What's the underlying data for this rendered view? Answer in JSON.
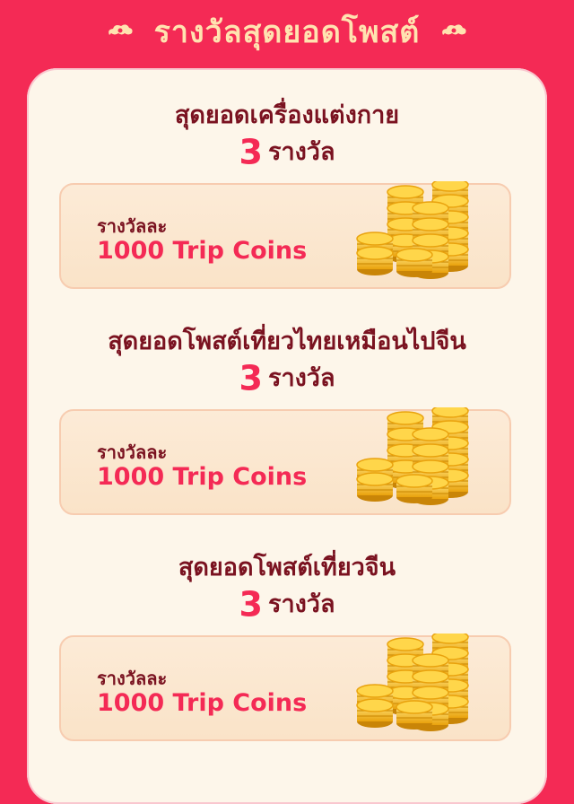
{
  "header": {
    "title": "รางวัลสุดยอดโพสต์"
  },
  "sections": [
    {
      "title": "สุดยอดเครื่องแต่งกาย",
      "count": "3",
      "count_unit": "รางวัล",
      "card": {
        "label": "รางวัลละ",
        "value": "1000 Trip Coins",
        "icon": "coin-stack-icon"
      }
    },
    {
      "title": "สุดยอดโพสต์เที่ยวไทยเหมือนไปจีน",
      "count": "3",
      "count_unit": "รางวัล",
      "card": {
        "label": "รางวัลละ",
        "value": "1000 Trip Coins",
        "icon": "coin-stack-icon"
      }
    },
    {
      "title": "สุดยอดโพสต์เที่ยวจีน",
      "count": "3",
      "count_unit": "รางวัล",
      "card": {
        "label": "รางวัลละ",
        "value": "1000 Trip Coins",
        "icon": "coin-stack-icon"
      }
    }
  ],
  "colors": {
    "background": "#f42a55",
    "panel": "#fdf6ea",
    "title": "#7a1220",
    "accent": "#f42a55",
    "header_text": "#ffe3b0"
  }
}
